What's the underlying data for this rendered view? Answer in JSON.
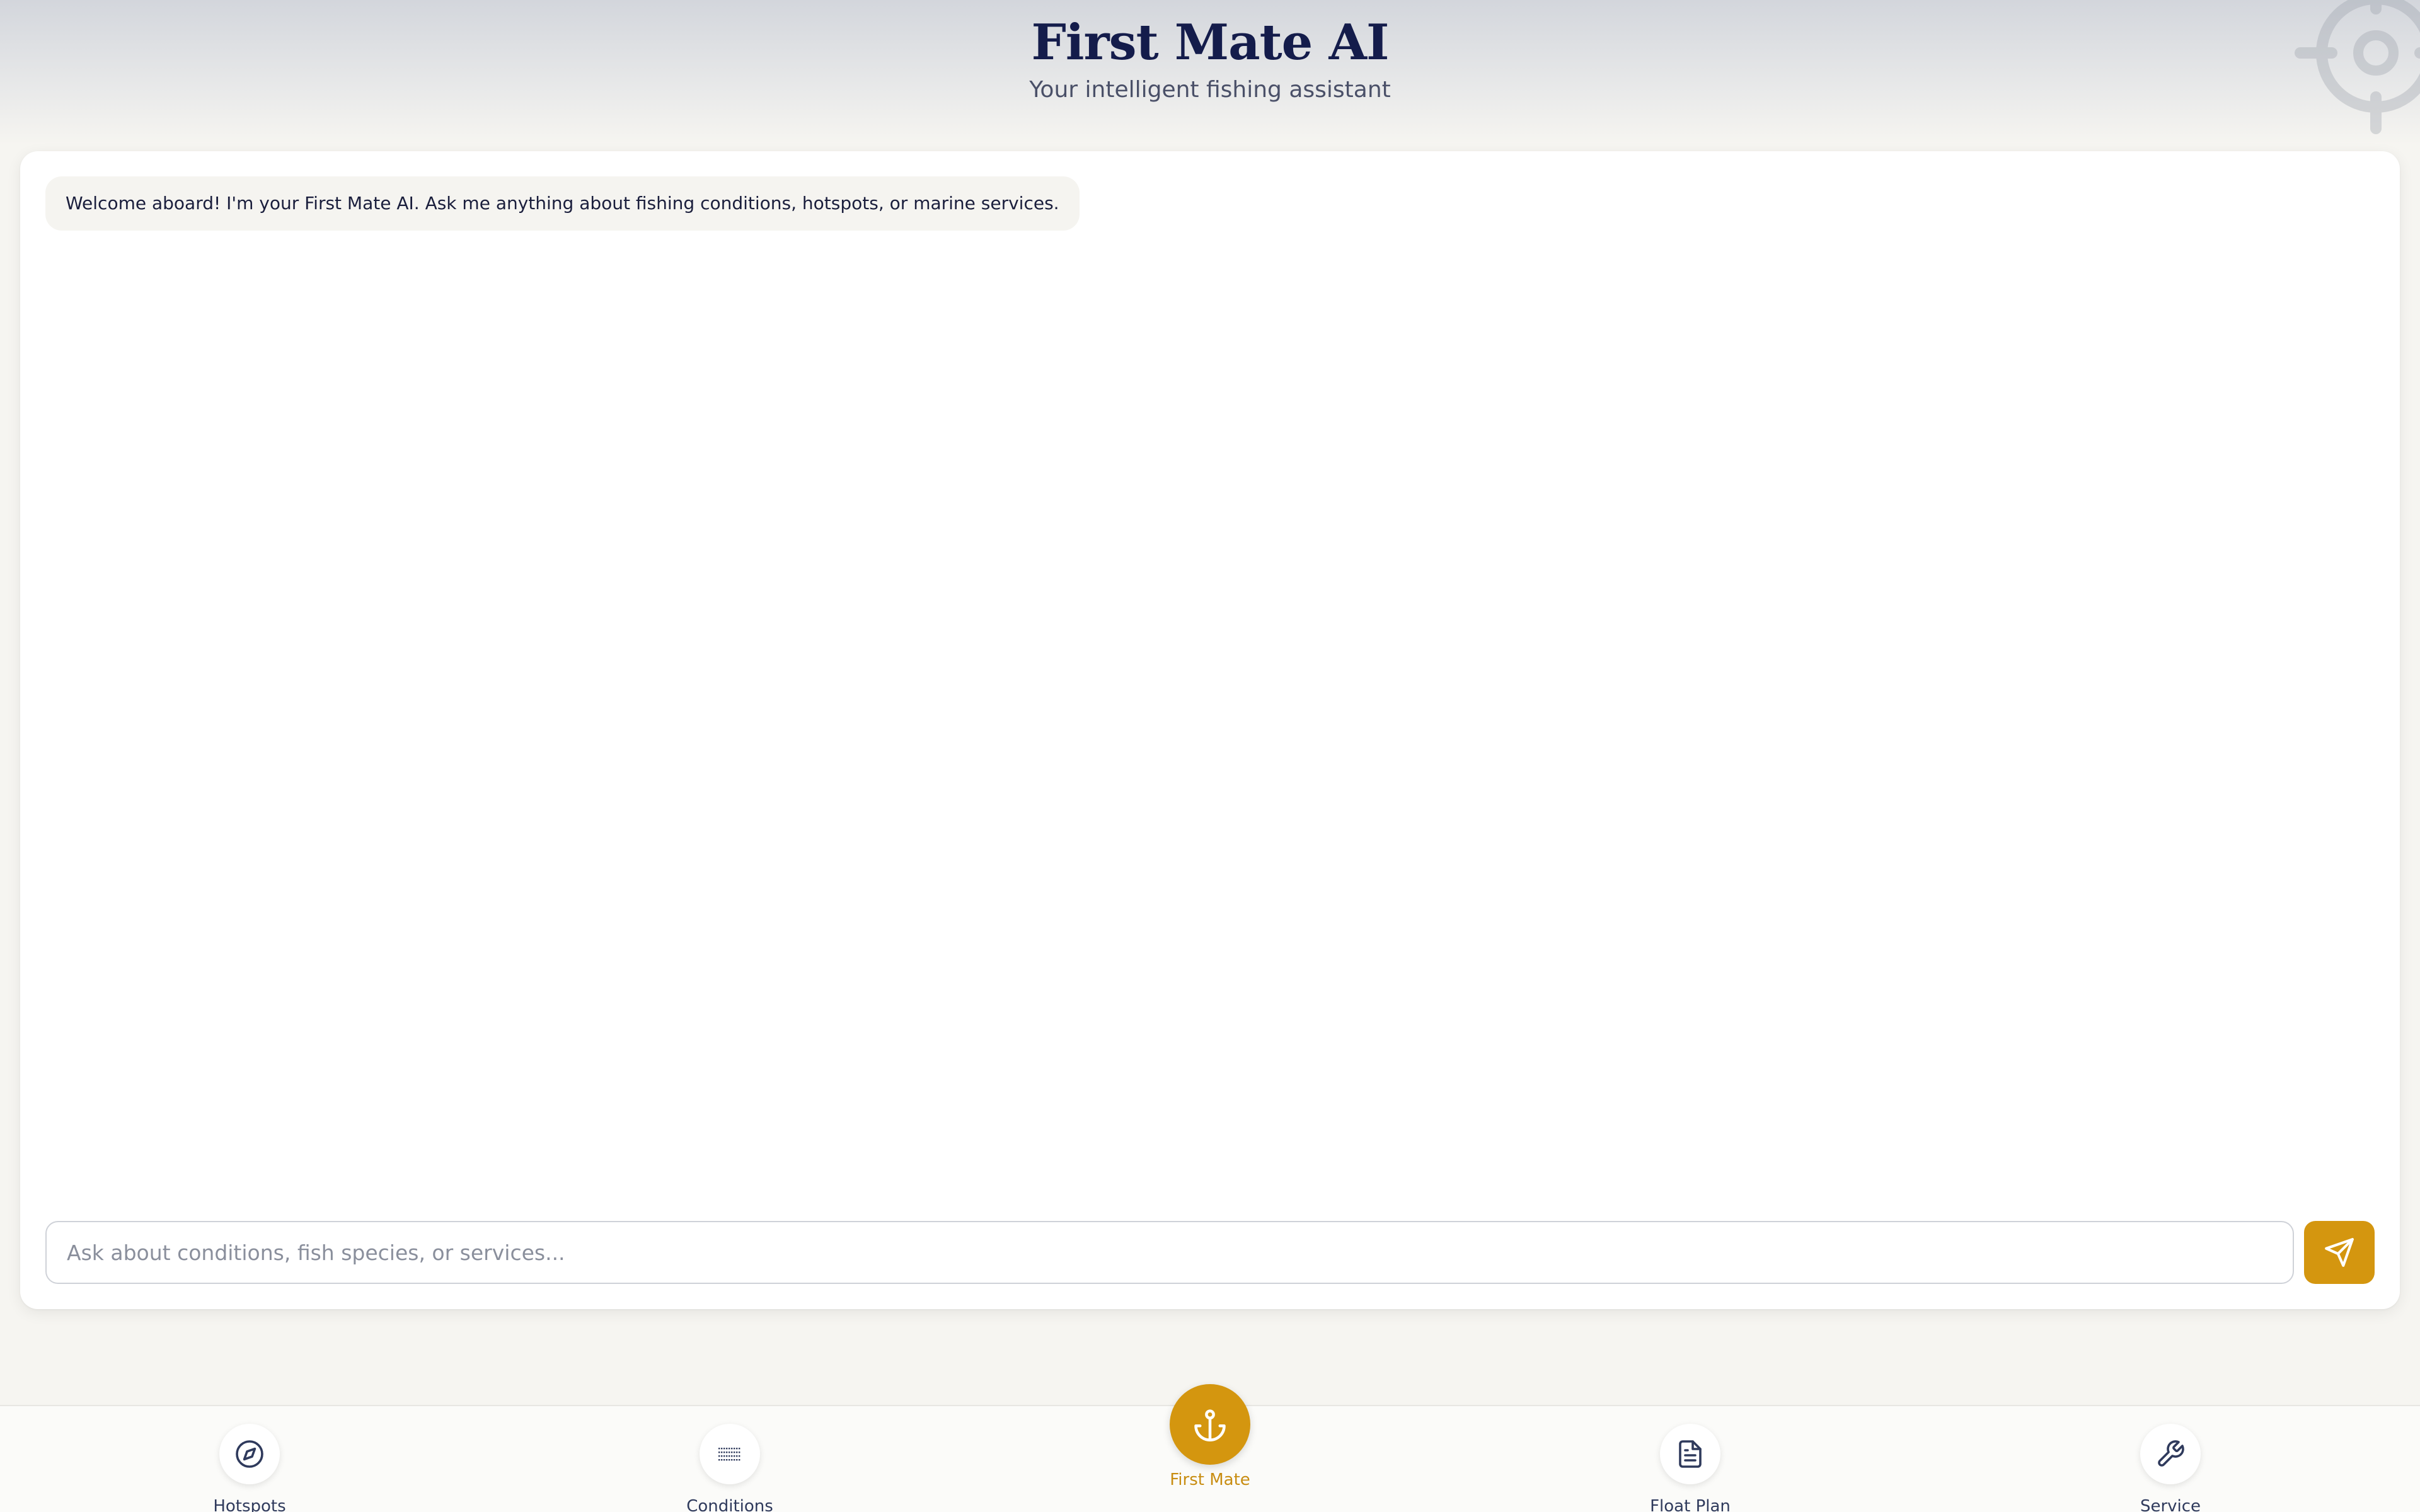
{
  "header": {
    "title": "First Mate AI",
    "subtitle": "Your intelligent fishing assistant"
  },
  "chat": {
    "messages": [
      {
        "role": "assistant",
        "text": "Welcome aboard! I'm your First Mate AI. Ask me anything about fishing conditions, hotspots, or marine services."
      }
    ]
  },
  "composer": {
    "placeholder": "Ask about conditions, fish species, or services...",
    "value": ""
  },
  "nav": {
    "items": [
      {
        "label": "Hotspots",
        "icon": "compass-icon"
      },
      {
        "label": "Conditions",
        "icon": "dots-grid-icon"
      },
      {
        "label": "First Mate",
        "icon": "anchor-icon",
        "active": true
      },
      {
        "label": "Float Plan",
        "icon": "document-icon"
      },
      {
        "label": "Service",
        "icon": "wrench-icon"
      }
    ]
  },
  "colors": {
    "accent": "#d4960f",
    "title": "#141c4b",
    "background": "#f6f5f1"
  }
}
